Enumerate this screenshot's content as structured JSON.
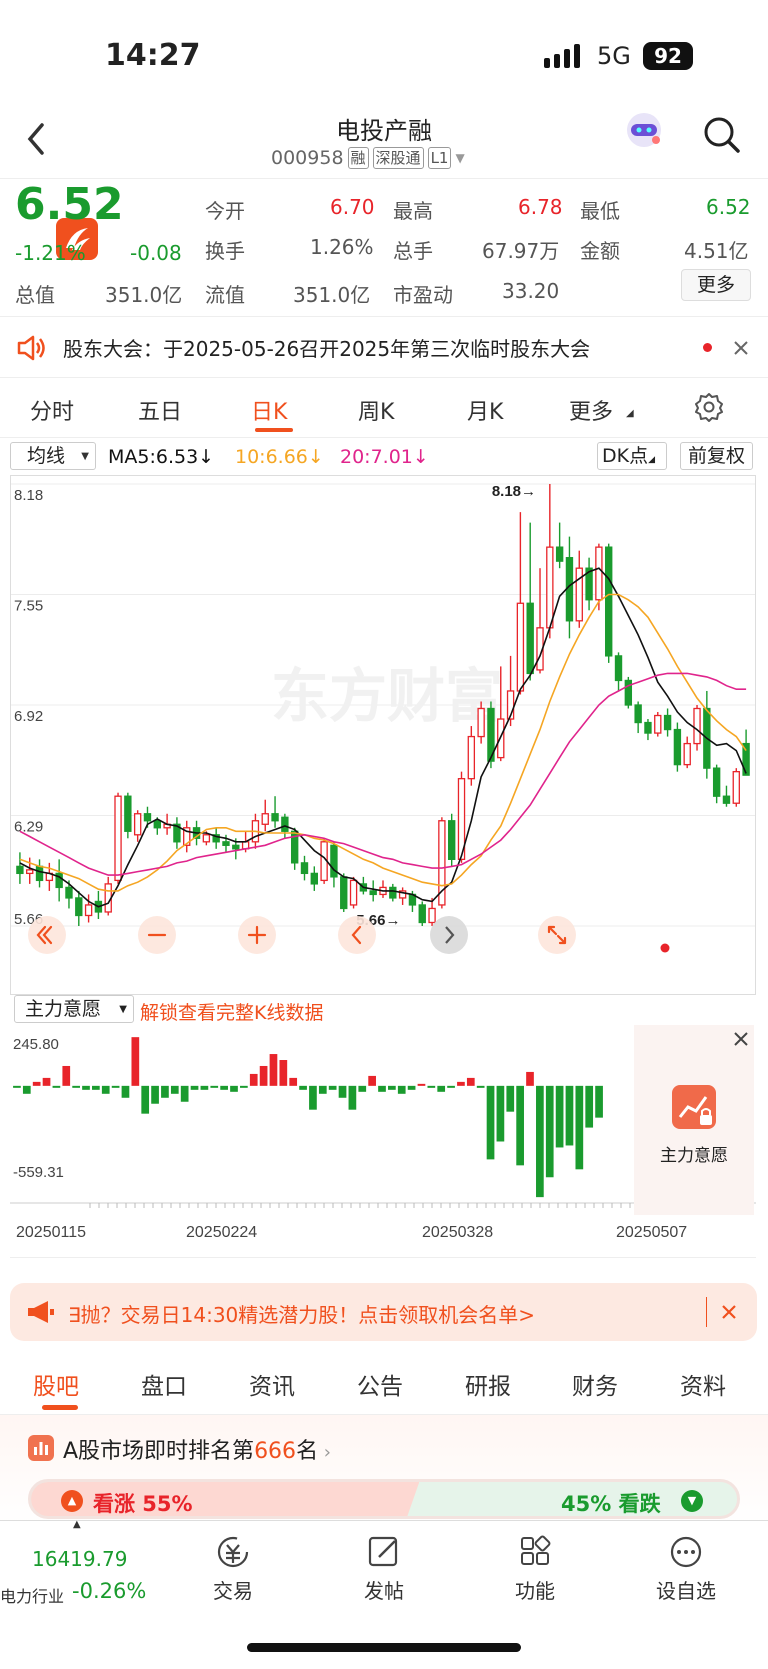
{
  "status_bar": {
    "time": "14:27",
    "network": "5G",
    "battery": "92"
  },
  "header": {
    "title": "电投产融",
    "code": "000958",
    "tags": [
      "融",
      "深股通",
      "L1"
    ]
  },
  "quote": {
    "price": "6.52",
    "change_pct": "-1.21%",
    "change": "-0.08",
    "rows": [
      [
        {
          "label": "今开",
          "value": "6.70",
          "color": "red"
        },
        {
          "label": "最高",
          "value": "6.78",
          "color": "red"
        },
        {
          "label": "最低",
          "value": "6.52",
          "color": "green"
        }
      ],
      [
        {
          "label": "换手",
          "value": "1.26%",
          "color": "gray"
        },
        {
          "label": "总手",
          "value": "67.97万",
          "color": "gray"
        },
        {
          "label": "金额",
          "value": "4.51亿",
          "color": "gray"
        }
      ],
      [
        {
          "label": "总值",
          "value": "351.0亿",
          "color": "gray"
        },
        {
          "label": "流值",
          "value": "351.0亿",
          "color": "gray"
        },
        {
          "label": "市盈动",
          "value": "33.20",
          "color": "gray"
        }
      ]
    ],
    "more_label": "更多"
  },
  "notice": {
    "text": "股东大会：于2025-05-26召开2025年第三次临时股东大会"
  },
  "tabs": [
    "分时",
    "五日",
    "日K",
    "周K",
    "月K",
    "更多"
  ],
  "active_tab": "日K",
  "kline_bar": {
    "ma_selector": "均线",
    "ma5": "MA5:6.53↓",
    "ma10": "10:6.66↓",
    "ma20": "20:7.01↓",
    "dk": "DK点",
    "adjust": "前复权"
  },
  "colors": {
    "red": "#e8242a",
    "green": "#1a9b2e",
    "accent": "#f0501e",
    "ma5": "#111111",
    "ma10": "#f5a623",
    "ma20": "#e0248c"
  },
  "chart_data": [
    {
      "type": "candlestick",
      "y_ticks": [
        "8.18",
        "7.55",
        "6.92",
        "6.29",
        "5.66"
      ],
      "ylim": [
        5.66,
        8.18
      ],
      "max_label": "8.18→",
      "min_label": "5.66→",
      "watermark": "东方财富",
      "candles": [
        [
          6.0,
          5.96,
          6.08,
          5.9
        ],
        [
          5.96,
          5.98,
          6.05,
          5.9
        ],
        [
          6.0,
          5.92,
          6.04,
          5.88
        ],
        [
          5.92,
          5.96,
          6.02,
          5.86
        ],
        [
          5.96,
          5.88,
          6.04,
          5.8
        ],
        [
          5.88,
          5.82,
          5.92,
          5.76
        ],
        [
          5.82,
          5.72,
          5.86,
          5.66
        ],
        [
          5.72,
          5.78,
          5.84,
          5.68
        ],
        [
          5.8,
          5.74,
          5.86,
          5.7
        ],
        [
          5.74,
          5.9,
          5.94,
          5.72
        ],
        [
          5.92,
          6.4,
          6.42,
          5.9
        ],
        [
          6.4,
          6.2,
          6.42,
          6.16
        ],
        [
          6.18,
          6.3,
          6.32,
          6.14
        ],
        [
          6.3,
          6.26,
          6.34,
          6.22
        ],
        [
          6.26,
          6.22,
          6.28,
          6.18
        ],
        [
          6.22,
          6.24,
          6.3,
          6.18
        ],
        [
          6.24,
          6.14,
          6.28,
          6.1
        ],
        [
          6.12,
          6.22,
          6.26,
          6.08
        ],
        [
          6.22,
          6.16,
          6.26,
          6.12
        ],
        [
          6.14,
          6.18,
          6.2,
          6.12
        ],
        [
          6.18,
          6.14,
          6.22,
          6.1
        ],
        [
          6.14,
          6.12,
          6.18,
          6.08
        ],
        [
          6.12,
          6.1,
          6.16,
          6.04
        ],
        [
          6.1,
          6.14,
          6.2,
          6.08
        ],
        [
          6.14,
          6.26,
          6.3,
          6.1
        ],
        [
          6.24,
          6.3,
          6.38,
          6.2
        ],
        [
          6.3,
          6.26,
          6.4,
          6.22
        ],
        [
          6.28,
          6.2,
          6.3,
          6.16
        ],
        [
          6.2,
          6.02,
          6.22,
          5.98
        ],
        [
          6.02,
          5.96,
          6.06,
          5.92
        ],
        [
          5.96,
          5.9,
          6.0,
          5.86
        ],
        [
          5.92,
          6.14,
          6.16,
          5.9
        ],
        [
          6.12,
          5.94,
          6.14,
          5.88
        ],
        [
          5.94,
          5.76,
          5.96,
          5.74
        ],
        [
          5.78,
          5.92,
          5.94,
          5.76
        ],
        [
          5.9,
          5.86,
          5.94,
          5.84
        ],
        [
          5.86,
          5.84,
          5.92,
          5.8
        ],
        [
          5.84,
          5.88,
          5.92,
          5.82
        ],
        [
          5.88,
          5.82,
          5.9,
          5.8
        ],
        [
          5.82,
          5.86,
          5.88,
          5.78
        ],
        [
          5.84,
          5.78,
          5.86,
          5.74
        ],
        [
          5.78,
          5.68,
          5.8,
          5.66
        ],
        [
          5.68,
          5.76,
          5.82,
          5.66
        ],
        [
          5.78,
          6.26,
          6.28,
          5.76
        ],
        [
          6.26,
          6.04,
          6.3,
          6.0
        ],
        [
          6.04,
          6.5,
          6.54,
          6.02
        ],
        [
          6.5,
          6.74,
          6.8,
          6.46
        ],
        [
          6.74,
          6.9,
          6.94,
          6.7
        ],
        [
          6.9,
          6.6,
          6.94,
          6.56
        ],
        [
          6.62,
          6.84,
          7.14,
          6.6
        ],
        [
          6.84,
          7.0,
          7.2,
          6.8
        ],
        [
          7.0,
          7.5,
          8.02,
          6.98
        ],
        [
          7.5,
          7.1,
          7.96,
          7.06
        ],
        [
          7.12,
          7.36,
          7.7,
          7.1
        ],
        [
          7.36,
          7.82,
          8.18,
          7.3
        ],
        [
          7.82,
          7.74,
          7.96,
          7.7
        ],
        [
          7.76,
          7.4,
          7.88,
          7.3
        ],
        [
          7.4,
          7.7,
          7.8,
          7.36
        ],
        [
          7.7,
          7.52,
          7.76,
          7.46
        ],
        [
          7.52,
          7.82,
          7.84,
          7.46
        ],
        [
          7.82,
          7.2,
          7.84,
          7.16
        ],
        [
          7.2,
          7.06,
          7.22,
          7.0
        ],
        [
          7.06,
          6.92,
          7.08,
          6.9
        ],
        [
          6.92,
          6.82,
          6.94,
          6.76
        ],
        [
          6.82,
          6.76,
          6.84,
          6.72
        ],
        [
          6.76,
          6.86,
          6.88,
          6.74
        ],
        [
          6.86,
          6.78,
          6.9,
          6.74
        ],
        [
          6.78,
          6.58,
          6.82,
          6.54
        ],
        [
          6.58,
          6.7,
          6.74,
          6.56
        ],
        [
          6.7,
          6.9,
          6.92,
          6.66
        ],
        [
          6.9,
          6.56,
          7.0,
          6.5
        ],
        [
          6.56,
          6.4,
          6.58,
          6.36
        ],
        [
          6.4,
          6.36,
          6.46,
          6.34
        ],
        [
          6.36,
          6.54,
          6.56,
          6.34
        ],
        [
          6.7,
          6.52,
          6.78,
          6.52
        ]
      ],
      "ma5": [
        6.02,
        5.99,
        5.97,
        5.96,
        5.94,
        5.9,
        5.85,
        5.8,
        5.77,
        5.79,
        5.89,
        6.01,
        6.12,
        6.24,
        6.27,
        6.24,
        6.23,
        6.2,
        6.19,
        6.19,
        6.17,
        6.16,
        6.14,
        6.14,
        6.17,
        6.19,
        6.21,
        6.23,
        6.21,
        6.15,
        6.09,
        6.05,
        5.98,
        5.94,
        5.93,
        5.88,
        5.87,
        5.86,
        5.86,
        5.85,
        5.84,
        5.81,
        5.8,
        5.86,
        5.91,
        6.06,
        6.26,
        6.51,
        6.62,
        6.74,
        6.86,
        7.01,
        7.09,
        7.2,
        7.36,
        7.54,
        7.6,
        7.64,
        7.68,
        7.7,
        7.64,
        7.54,
        7.43,
        7.32,
        7.19,
        7.05,
        6.97,
        6.88,
        6.82,
        6.78,
        6.73,
        6.69,
        6.7,
        6.66,
        6.53
      ],
      "ma10": [
        6.04,
        6.02,
        6.0,
        5.99,
        5.97,
        5.95,
        5.93,
        5.9,
        5.87,
        5.86,
        5.86,
        5.89,
        5.91,
        5.94,
        5.98,
        6.03,
        6.09,
        6.13,
        6.17,
        6.21,
        6.22,
        6.22,
        6.2,
        6.2,
        6.2,
        6.19,
        6.19,
        6.19,
        6.19,
        6.18,
        6.16,
        6.15,
        6.13,
        6.1,
        6.07,
        6.04,
        6.02,
        5.99,
        5.97,
        5.95,
        5.93,
        5.91,
        5.9,
        5.89,
        5.9,
        5.95,
        6.01,
        6.06,
        6.15,
        6.23,
        6.36,
        6.5,
        6.64,
        6.78,
        6.94,
        7.08,
        7.21,
        7.32,
        7.42,
        7.51,
        7.55,
        7.55,
        7.52,
        7.48,
        7.42,
        7.33,
        7.24,
        7.14,
        7.05,
        6.96,
        6.89,
        6.83,
        6.78,
        6.74,
        6.66
      ],
      "ma20": [
        6.2,
        6.17,
        6.14,
        6.11,
        6.08,
        6.05,
        6.02,
        5.99,
        5.97,
        5.95,
        5.95,
        5.96,
        5.97,
        5.98,
        5.99,
        6.0,
        6.02,
        6.03,
        6.05,
        6.06,
        6.07,
        6.08,
        6.09,
        6.1,
        6.11,
        6.12,
        6.14,
        6.16,
        6.17,
        6.18,
        6.17,
        6.16,
        6.14,
        6.13,
        6.11,
        6.09,
        6.07,
        6.05,
        6.04,
        6.02,
        6.01,
        6.0,
        5.99,
        5.99,
        6.0,
        6.01,
        6.04,
        6.07,
        6.11,
        6.15,
        6.21,
        6.28,
        6.35,
        6.44,
        6.53,
        6.62,
        6.71,
        6.78,
        6.85,
        6.92,
        6.97,
        7.0,
        7.03,
        7.05,
        7.07,
        7.09,
        7.1,
        7.1,
        7.1,
        7.09,
        7.08,
        7.06,
        7.03,
        7.01,
        7.01
      ]
    },
    {
      "type": "bar",
      "name": "主力意愿",
      "ylim": [
        -559.31,
        245.8
      ],
      "y_ticks": [
        "245.80",
        "-559.31"
      ],
      "x_ticks": [
        "20250115",
        "20250224",
        "20250328",
        "20250507"
      ],
      "values": [
        -10,
        -40,
        20,
        40,
        -10,
        100,
        -10,
        -20,
        -20,
        -40,
        -10,
        -60,
        245,
        -140,
        -90,
        -60,
        -40,
        -80,
        -20,
        -20,
        -10,
        -20,
        -30,
        -10,
        60,
        100,
        160,
        130,
        40,
        -20,
        -120,
        -40,
        -20,
        -60,
        -120,
        -30,
        50,
        -30,
        -20,
        -40,
        -20,
        10,
        -10,
        -30,
        -10,
        20,
        40,
        -10,
        -370,
        -280,
        -130,
        -400,
        70,
        -560,
        -460,
        -310,
        -300,
        -420,
        -210,
        -160
      ]
    }
  ],
  "indicator": {
    "selector": "主力意愿",
    "unlock_text": "解锁查看完整K线数据",
    "locked_label": "主力意愿"
  },
  "promo": {
    "text": "∃抛？交易日14:30精选潜力股！点击领取机会名单>"
  },
  "sub_tabs": [
    "股吧",
    "盘口",
    "资讯",
    "公告",
    "研报",
    "财务",
    "资料"
  ],
  "rank": {
    "prefix": "A股市场即时排名第",
    "number": "666",
    "suffix": "名",
    "up": "看涨 55%",
    "down": "45% 看跌"
  },
  "bottom": {
    "index_value": "16419.79",
    "industry": "电力行业",
    "industry_change": "-0.26%",
    "items": [
      "交易",
      "发帖",
      "功能",
      "设自选"
    ]
  }
}
